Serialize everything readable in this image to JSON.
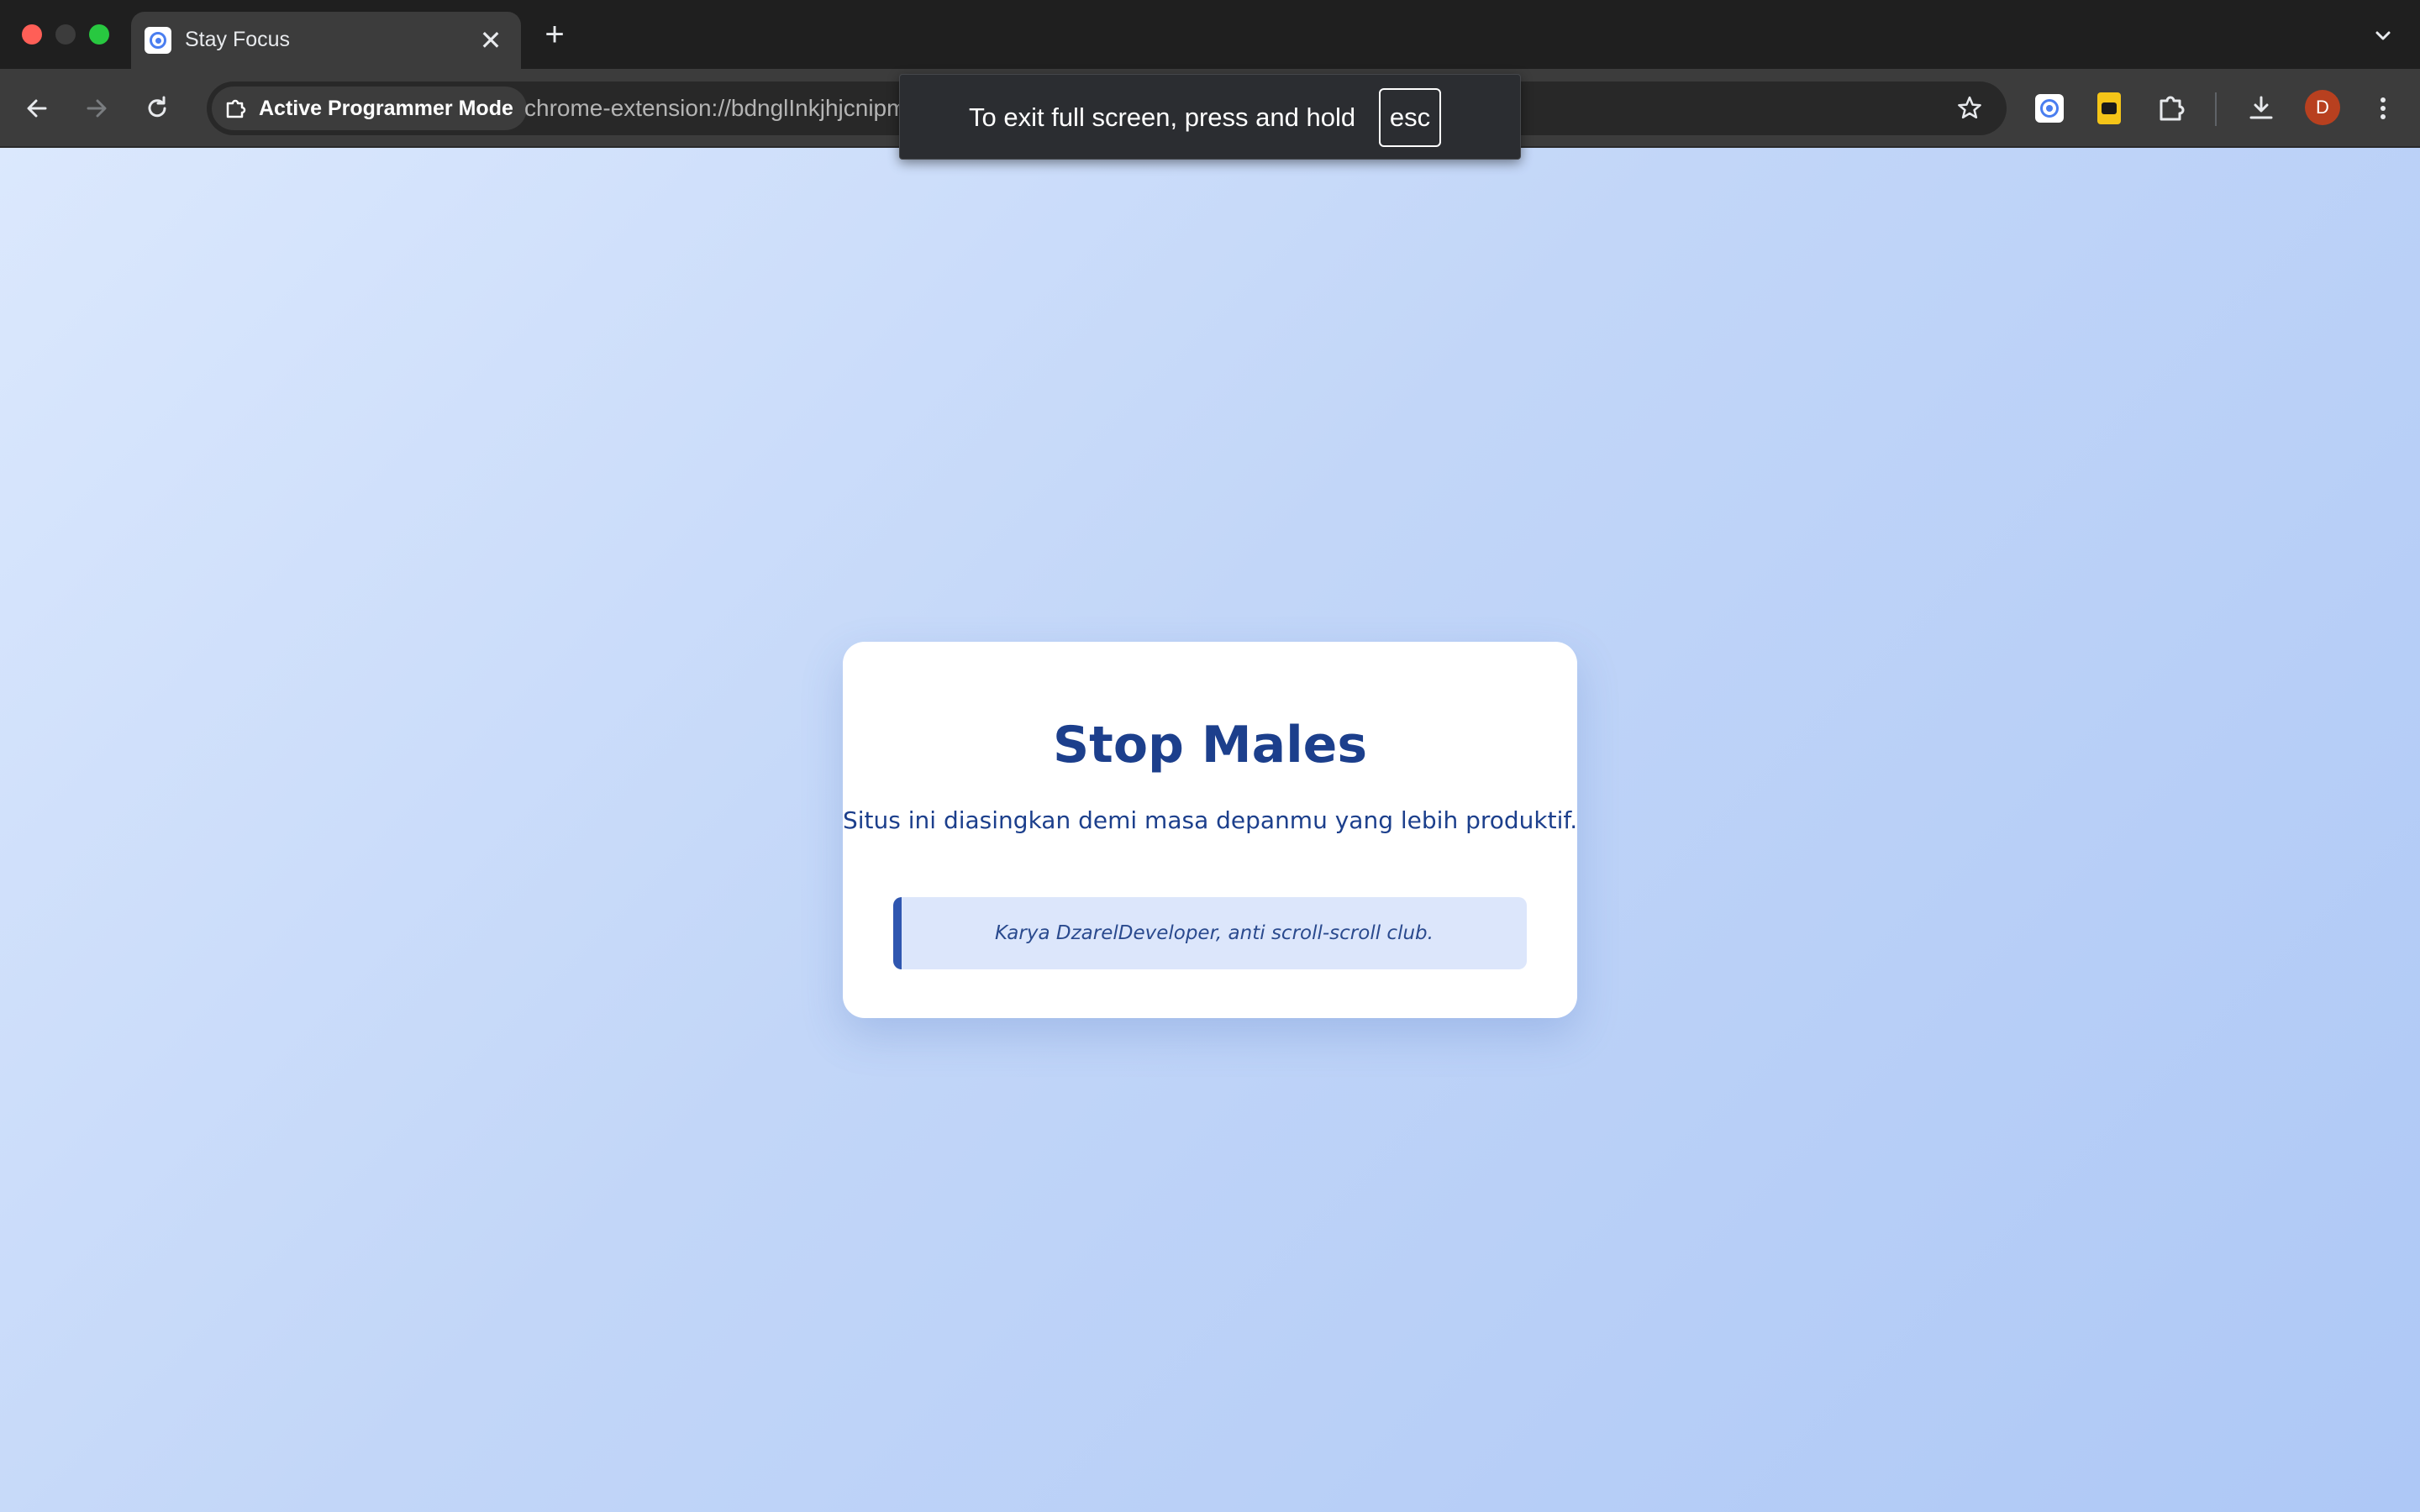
{
  "browser": {
    "tab": {
      "title": "Stay Focus",
      "close_glyph": "✕",
      "favicon": "eye-icon"
    },
    "new_tab_glyph": "+",
    "omnibox": {
      "chip_label": "Active Programmer Mode",
      "url": "chrome-extension://bdnglInkjhjcnipmhbefljmcmghcdcml/blocked.html"
    },
    "profile_initial": "D"
  },
  "fullscreen_toast": {
    "message": "To exit full screen, press and hold",
    "key": "esc"
  },
  "page": {
    "title": "Stop Males",
    "message": "Situs ini diasingkan demi masa depanmu yang lebih produktif.",
    "quote": "Karya DzarelDeveloper, anti scroll-scroll club."
  },
  "colors": {
    "card_title": "#1c3f8c",
    "quote_border": "#2f56b0",
    "quote_bg": "#dce6fb",
    "background_start": "#dbe8fd",
    "background_end": "#aec8f6"
  }
}
